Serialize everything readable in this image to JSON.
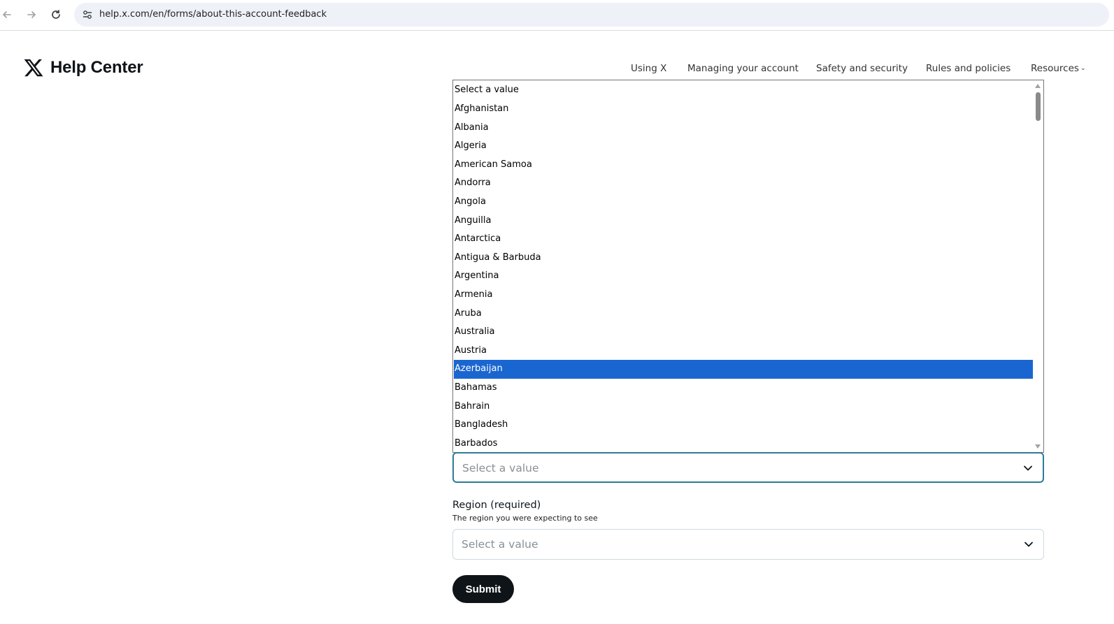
{
  "browser": {
    "url": "help.x.com/en/forms/about-this-account-feedback"
  },
  "site": {
    "title": "Help Center"
  },
  "nav": {
    "items": [
      "Using X",
      "Managing your account",
      "Safety and security",
      "Rules and policies",
      "Resources"
    ]
  },
  "listbox": {
    "options": [
      "Select a value",
      "Afghanistan",
      "Albania",
      "Algeria",
      "American Samoa",
      "Andorra",
      "Angola",
      "Anguilla",
      "Antarctica",
      "Antigua & Barbuda",
      "Argentina",
      "Armenia",
      "Aruba",
      "Australia",
      "Austria",
      "Azerbaijan",
      "Bahamas",
      "Bahrain",
      "Bangladesh",
      "Barbados"
    ],
    "highlighted": "Azerbaijan",
    "highlight_color": "#1a66d0"
  },
  "country_select": {
    "value": "Select a value"
  },
  "region": {
    "label": "Region",
    "required": "(required)",
    "help": "The region you were expecting to see",
    "value": "Select a value"
  },
  "submit": {
    "label": "Submit"
  }
}
